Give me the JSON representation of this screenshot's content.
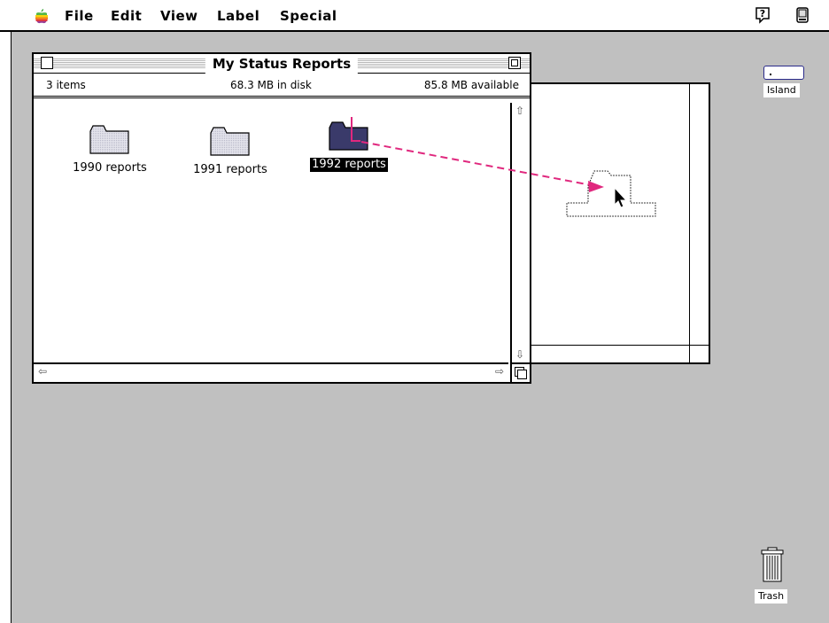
{
  "menubar": {
    "apple_icon": "apple-rainbow-icon",
    "menus": [
      "File",
      "Edit",
      "View",
      "Label",
      "Special"
    ],
    "help_icon": "balloon-help-icon",
    "app_icon": "finder-application-icon"
  },
  "window": {
    "title": "My Status Reports",
    "info": {
      "items": "3 items",
      "in_disk": "68.3 MB in disk",
      "available": "85.8 MB available"
    },
    "folders": [
      {
        "label": "1990 reports",
        "selected": false
      },
      {
        "label": "1991 reports",
        "selected": false
      },
      {
        "label": "1992 reports",
        "selected": true
      }
    ]
  },
  "desktop": {
    "disk_label": "Island",
    "trash_label": "Trash"
  },
  "colors": {
    "desktop": "#c0c0c0",
    "drag_path": "#e0287e",
    "selected_folder": "#3a3a6a"
  }
}
